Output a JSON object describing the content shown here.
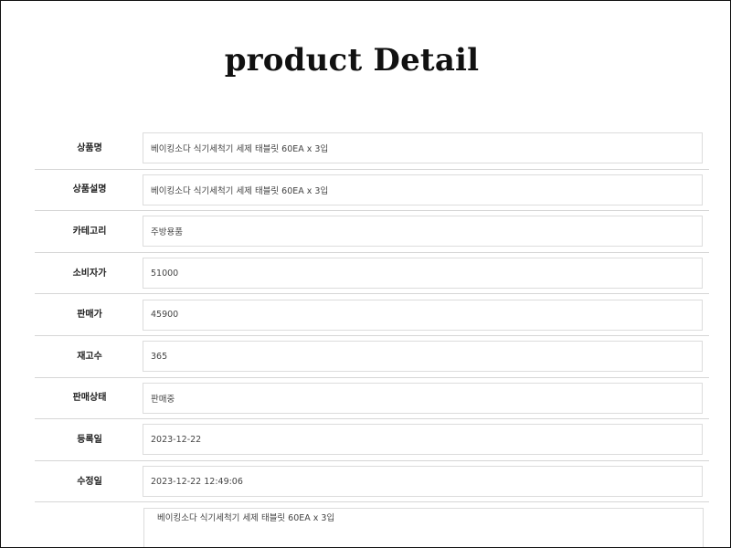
{
  "page": {
    "title": "product Detail"
  },
  "fields": [
    {
      "label": "상품명",
      "value": "베이킹소다 식기세척기 세제 태블릿 60EA x 3입"
    },
    {
      "label": "상품설명",
      "value": "베이킹소다 식기세척기 세제 태블릿 60EA x 3입"
    },
    {
      "label": "카테고리",
      "value": "주방용품"
    },
    {
      "label": "소비자가",
      "value": "51000"
    },
    {
      "label": "판매가",
      "value": "45900"
    },
    {
      "label": "재고수",
      "value": "365"
    },
    {
      "label": "판매상태",
      "value": "판매중"
    },
    {
      "label": "등록일",
      "value": "2023-12-22"
    },
    {
      "label": "수정일",
      "value": "2023-12-22 12:49:06"
    }
  ],
  "description_area": {
    "value": "베이킹소다 식기세척기 세제 태블릿 60EA x 3입"
  }
}
